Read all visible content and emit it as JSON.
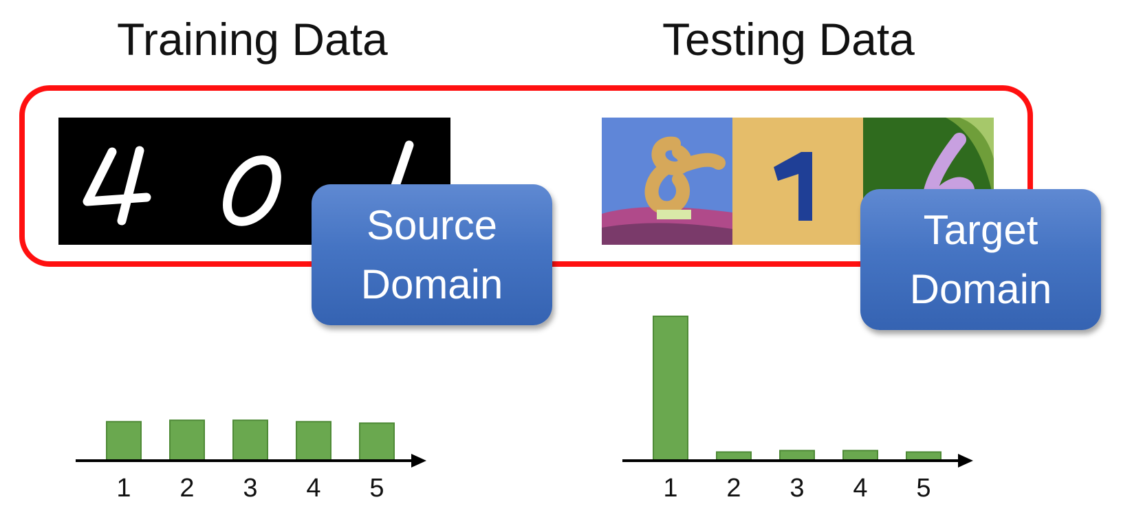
{
  "titles": {
    "training": "Training Data",
    "testing": "Testing Data"
  },
  "source_digits": [
    "4",
    "0",
    "1"
  ],
  "target_digits": [
    "8",
    "1",
    "6"
  ],
  "badges": {
    "source": {
      "line1": "Source",
      "line2": "Domain"
    },
    "target": {
      "line1": "Target",
      "line2": "Domain"
    }
  },
  "colors": {
    "frame": "#ff1010",
    "badge": "#4574c3",
    "bar": "#6aa84f",
    "bar_border": "#4e8a36"
  },
  "chart_data": [
    {
      "type": "bar",
      "categories": [
        "1",
        "2",
        "3",
        "4",
        "5"
      ],
      "values": [
        0.27,
        0.28,
        0.28,
        0.27,
        0.26
      ],
      "ylim": [
        0,
        1
      ]
    },
    {
      "type": "bar",
      "categories": [
        "1",
        "2",
        "3",
        "4",
        "5"
      ],
      "values": [
        1.0,
        0.06,
        0.07,
        0.07,
        0.06
      ],
      "ylim": [
        0,
        1
      ]
    }
  ]
}
